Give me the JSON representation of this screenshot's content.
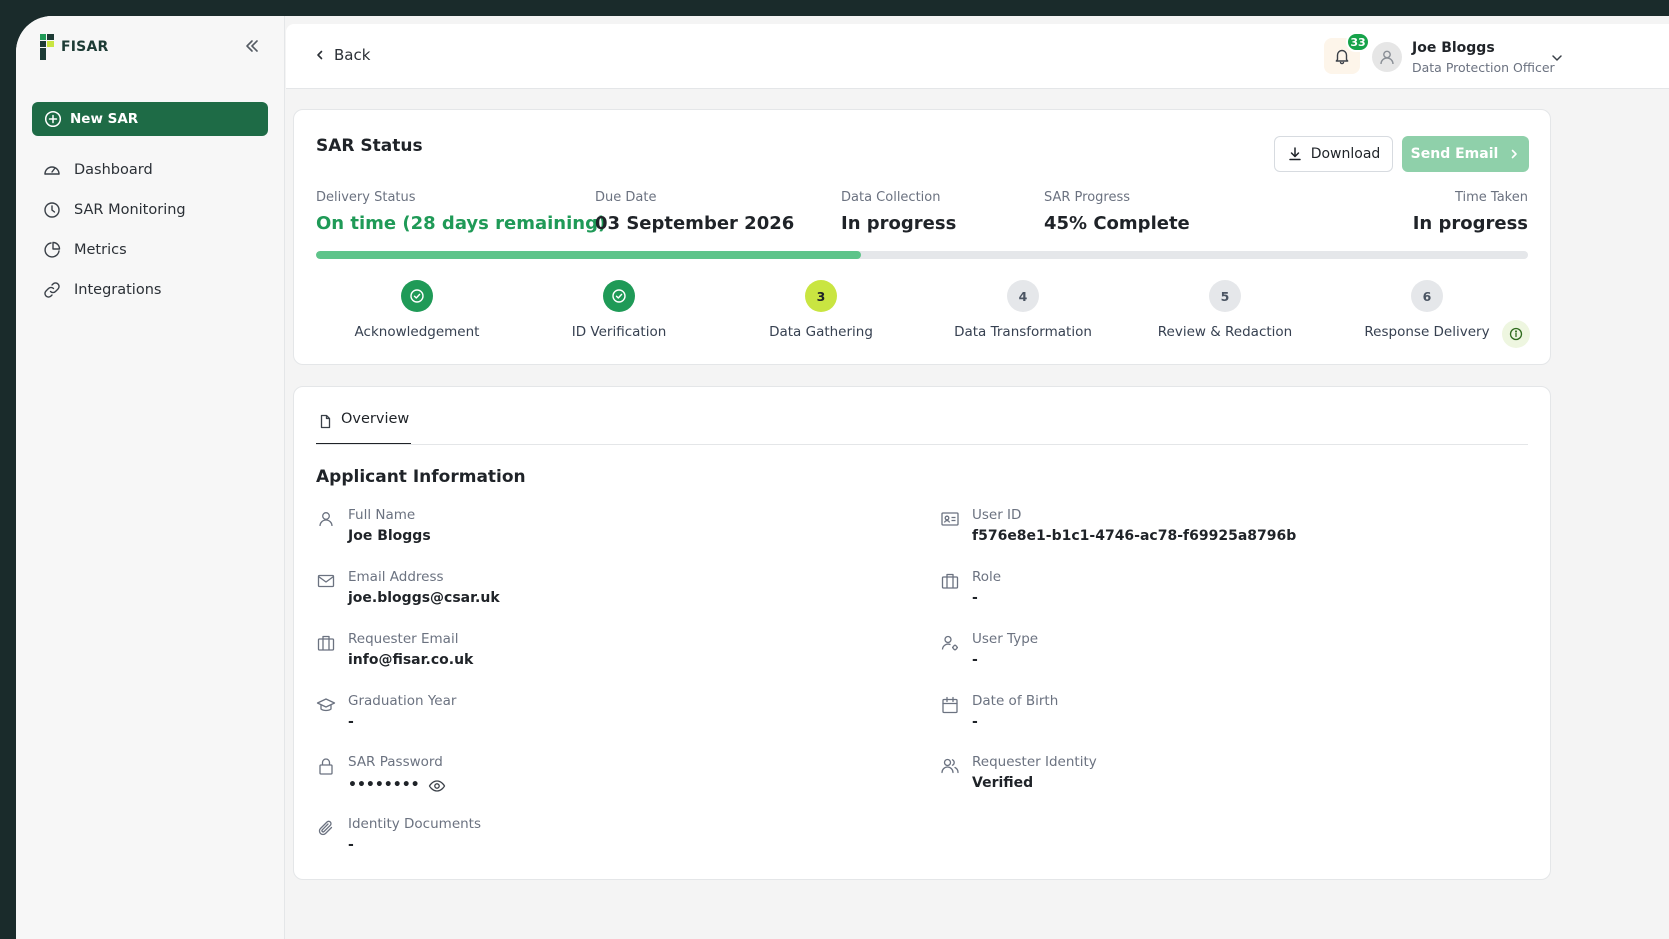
{
  "sidebar": {
    "logo_text": "FISAR",
    "new_sar_label": "New SAR",
    "items": [
      {
        "label": "Dashboard",
        "icon": "gauge-icon"
      },
      {
        "label": "SAR Monitoring",
        "icon": "clock-icon"
      },
      {
        "label": "Metrics",
        "icon": "pie-chart-icon"
      },
      {
        "label": "Integrations",
        "icon": "link-icon"
      }
    ]
  },
  "header": {
    "back_label": "Back",
    "notification_count": "33",
    "user_name": "Joe Bloggs",
    "user_role": "Data Protection Officer"
  },
  "status": {
    "title": "SAR Status",
    "download_label": "Download",
    "send_email_label": "Send Email",
    "metrics": [
      {
        "label": "Delivery Status",
        "value": "On time (28 days remaining)"
      },
      {
        "label": "Due Date",
        "value": "03 September 2026"
      },
      {
        "label": "Data Collection",
        "value": "In progress"
      },
      {
        "label": "SAR Progress",
        "value": "45% Complete"
      },
      {
        "label": "Time Taken",
        "value": "In progress"
      }
    ],
    "progress_fraction": 0.45,
    "steps": [
      {
        "number": "1",
        "label": "Acknowledgement",
        "state": "done"
      },
      {
        "number": "2",
        "label": "ID Verification",
        "state": "done"
      },
      {
        "number": "3",
        "label": "Data Gathering",
        "state": "current"
      },
      {
        "number": "4",
        "label": "Data Transformation",
        "state": "pending"
      },
      {
        "number": "5",
        "label": "Review & Redaction",
        "state": "pending"
      },
      {
        "number": "6",
        "label": "Response Delivery",
        "state": "pending"
      }
    ],
    "colors": {
      "accent": "#1e6b46",
      "done": "#1f9a57",
      "current": "#c9e541",
      "progress": "#5ec48a"
    }
  },
  "overview": {
    "tab_label": "Overview",
    "section_title": "Applicant Information",
    "fields_left": [
      {
        "label": "Full Name",
        "value": "Joe Bloggs",
        "icon": "user-icon"
      },
      {
        "label": "Email Address",
        "value": "joe.bloggs@csar.uk",
        "icon": "mail-icon"
      },
      {
        "label": "Requester Email",
        "value": "info@fisar.co.uk",
        "icon": "briefcase-icon"
      },
      {
        "label": "Graduation Year",
        "value": "-",
        "icon": "graduation-cap-icon"
      },
      {
        "label": "SAR Password",
        "value": "••••••••",
        "icon": "lock-icon"
      },
      {
        "label": "Identity Documents",
        "value": "-",
        "icon": "paperclip-icon"
      }
    ],
    "fields_right": [
      {
        "label": "User ID",
        "value": "f576e8e1-b1c1-4746-ac78-f69925a8796b",
        "icon": "id-card-icon"
      },
      {
        "label": "Role",
        "value": "-",
        "icon": "briefcase-icon"
      },
      {
        "label": "User Type",
        "value": "-",
        "icon": "user-cog-icon"
      },
      {
        "label": "Date of Birth",
        "value": "-",
        "icon": "calendar-icon"
      },
      {
        "label": "Requester Identity",
        "value": "Verified",
        "icon": "users-icon"
      }
    ]
  }
}
